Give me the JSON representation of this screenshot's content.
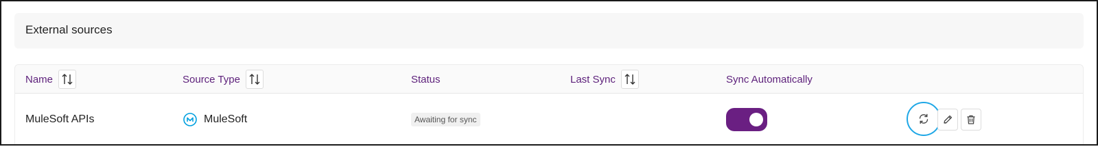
{
  "header": {
    "title": "External sources"
  },
  "table": {
    "columns": [
      {
        "label": "Name",
        "sortable": true
      },
      {
        "label": "Source Type",
        "sortable": true
      },
      {
        "label": "Status",
        "sortable": false
      },
      {
        "label": "Last Sync",
        "sortable": true
      },
      {
        "label": "Sync Automatically",
        "sortable": false
      }
    ],
    "rows": [
      {
        "name": "MuleSoft APIs",
        "source_type": "MuleSoft",
        "source_icon": "mulesoft-logo-icon",
        "status": "Awaiting for sync",
        "last_sync": "",
        "sync_automatically": true
      }
    ]
  },
  "actions": {
    "sync_icon": "refresh-icon",
    "edit_icon": "pencil-icon",
    "delete_icon": "trash-icon"
  },
  "colors": {
    "accent": "#6a1f82",
    "header_text": "#5c1f7a",
    "highlight_ring": "#1ea7e6"
  }
}
